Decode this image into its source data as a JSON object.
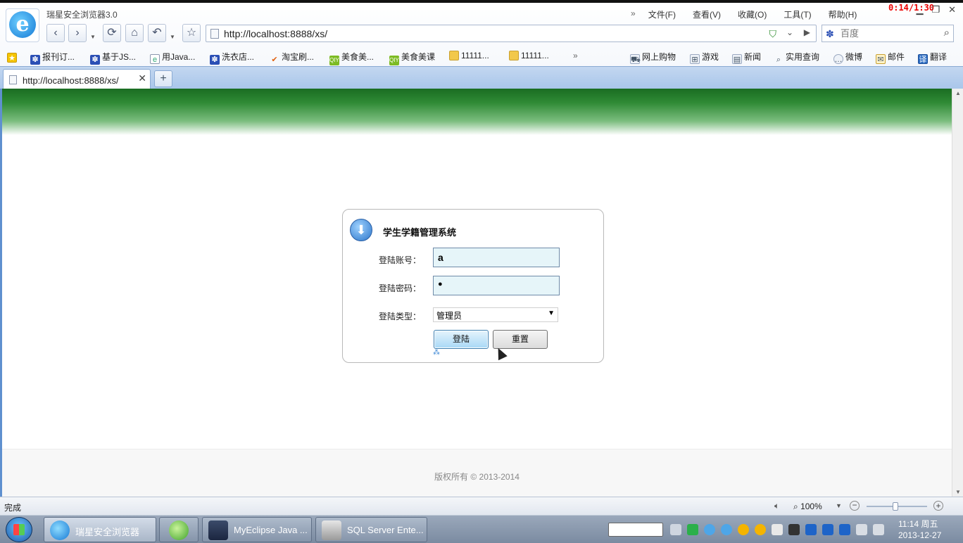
{
  "browser": {
    "app_title": "瑞星安全浏览器3.0",
    "menu": [
      "文件(F)",
      "查看(V)",
      "收藏(O)",
      "工具(T)",
      "帮助(H)"
    ],
    "menu_more": "»",
    "timer": "0:14/1:30",
    "url": "http://localhost:8888/xs/",
    "search_placeholder": "百度",
    "favorites": [
      {
        "label": "报刊订...",
        "icon": "baidu-paw-icon"
      },
      {
        "label": "基于JS...",
        "icon": "baidu-paw-icon"
      },
      {
        "label": "用Java...",
        "icon": "page-icon"
      },
      {
        "label": "洗衣店...",
        "icon": "baidu-paw-icon"
      },
      {
        "label": "淘宝刷...",
        "icon": "taobao-icon"
      },
      {
        "label": "美食美...",
        "icon": "iqiyi-icon"
      },
      {
        "label": "美食美课",
        "icon": "iqiyi-icon"
      },
      {
        "label": "11111...",
        "icon": "folder-icon"
      },
      {
        "label": "11111...",
        "icon": "folder-icon"
      }
    ],
    "favorites_more": "»",
    "quick_links": [
      "网上购物",
      "游戏",
      "新闻",
      "实用查询",
      "微博",
      "邮件",
      "翻译"
    ],
    "tab_title": "http://localhost:8888/xs/",
    "new_tab": "+"
  },
  "login": {
    "title": "学生学籍管理系统",
    "account_label": "登陆账号：",
    "account_value": "a",
    "password_label": "登陆密码：",
    "password_value": "●",
    "type_label": "登陆类型：",
    "type_value": "管理员",
    "login_button": "登陆",
    "reset_button": "重置"
  },
  "footer": {
    "copyright": "版权所有 © 2013-2014"
  },
  "statusbar": {
    "status": "完成",
    "zoom": "100%"
  },
  "taskbar": {
    "tasks": [
      "瑞星安全浏览器",
      "MyEclipse Java ...",
      "SQL Server Ente..."
    ],
    "time": "11:14 周五",
    "date": "2013-12-27"
  }
}
